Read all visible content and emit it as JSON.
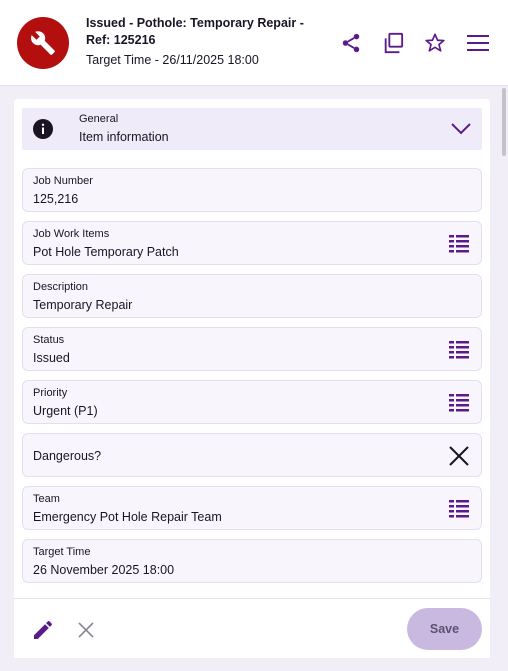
{
  "header": {
    "title": "Issued - Pothole: Temporary Repair - Ref: 125216",
    "subtitle": "Target Time - 26/11/2025 18:00",
    "icons": [
      "share-icon",
      "copy-icon",
      "star-icon",
      "menu-icon"
    ],
    "avatar_icon": "wrench-icon"
  },
  "section": {
    "category": "General",
    "title": "Item information",
    "icon": "info-icon",
    "toggle_icon": "chevron-down-icon"
  },
  "fields": [
    {
      "label": "Job Number",
      "value": "125,216"
    },
    {
      "label": "Job Work Items",
      "value": "Pot Hole Temporary Patch",
      "icon": "list-icon"
    },
    {
      "label": "Description",
      "value": "Temporary Repair"
    },
    {
      "label": "Status",
      "value": "Issued",
      "icon": "list-icon"
    },
    {
      "label": "Priority",
      "value": "Urgent (P1)",
      "icon": "list-icon"
    },
    {
      "label": "Dangerous?",
      "icon": "close-icon"
    },
    {
      "label": "Team",
      "value": "Emergency Pot Hole Repair Team",
      "icon": "list-icon"
    },
    {
      "label": "Target Time",
      "value": "26 November 2025 18:00"
    }
  ],
  "footer": {
    "save_label": "Save",
    "edit_icon": "pencil-icon",
    "cancel_icon": "close-icon"
  },
  "colors": {
    "accent": "#5b1a8c",
    "avatar": "#b30f0f",
    "save_button": "#c9b9e0"
  }
}
